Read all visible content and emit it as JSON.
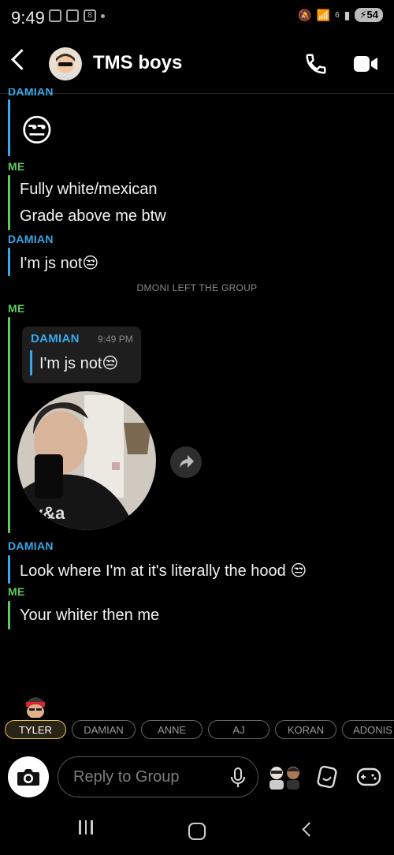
{
  "status_bar": {
    "time": "9:49",
    "badge_count": "8",
    "signal_label": "6",
    "battery": "54"
  },
  "header": {
    "title": "TMS boys",
    "icons": {
      "back": "chevron-left-icon",
      "call": "phone-icon",
      "video": "video-camera-icon"
    }
  },
  "messages": {
    "top_label": "DAMIAN",
    "m1_emoji": "😒",
    "me_label_1": "ME",
    "m2": "Fully white/mexican",
    "m3": "Grade above me btw",
    "damian_label_2": "DAMIAN",
    "m4": "I'm js not😒",
    "system": "DMONI LEFT THE GROUP",
    "me_label_2": "ME",
    "quote": {
      "sender": "DAMIAN",
      "time": "9:49 PM",
      "text": "I'm js not😒"
    },
    "damian_label_3": "DAMIAN",
    "m5": "Look where I'm at it's literally the hood 😒",
    "me_label_3": "ME",
    "m6": "Your whiter then me"
  },
  "members": [
    "TYLER",
    "DAMIAN",
    "ANNE",
    "AJ",
    "KORAN",
    "ADONIS"
  ],
  "composer": {
    "placeholder": "Reply to Group"
  },
  "colors": {
    "damian": "#35a9ec",
    "me": "#60c862",
    "active_chip": "#e8c255"
  }
}
